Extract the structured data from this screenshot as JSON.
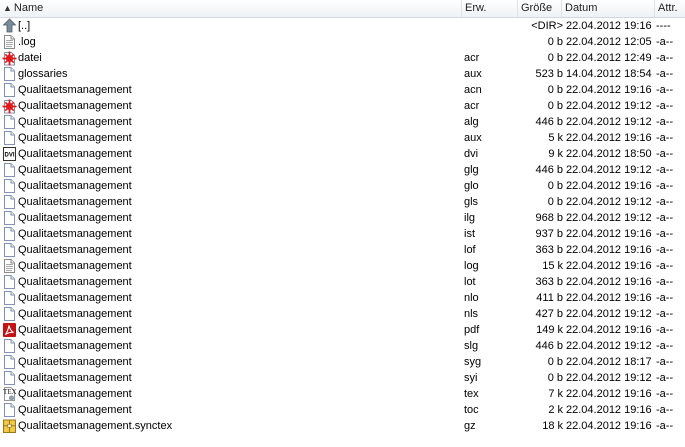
{
  "header": {
    "name": "Name",
    "ext": "Erw.",
    "size": "Größe",
    "date": "Datum",
    "attr": "Attr."
  },
  "files": [
    {
      "name": "[..]",
      "ext": "",
      "size": "<DIR>",
      "date": "22.04.2012 19:16",
      "attr": "----",
      "icon": "up-folder-icon"
    },
    {
      "name": ".log",
      "ext": "",
      "size": "0 b",
      "date": "22.04.2012 12:05",
      "attr": "-a--",
      "icon": "text-file-icon"
    },
    {
      "name": "datei",
      "ext": "acr",
      "size": "0 b",
      "date": "22.04.2012 12:49",
      "attr": "-a--",
      "icon": "acrobat-red-splash-icon"
    },
    {
      "name": "glossaries",
      "ext": "aux",
      "size": "523 b",
      "date": "14.04.2012 18:54",
      "attr": "-a--",
      "icon": "blank-file-icon"
    },
    {
      "name": "Qualitaetsmanagement",
      "ext": "acn",
      "size": "0 b",
      "date": "22.04.2012 19:16",
      "attr": "-a--",
      "icon": "blank-file-icon"
    },
    {
      "name": "Qualitaetsmanagement",
      "ext": "acr",
      "size": "0 b",
      "date": "22.04.2012 19:12",
      "attr": "-a--",
      "icon": "acrobat-red-splash-icon"
    },
    {
      "name": "Qualitaetsmanagement",
      "ext": "alg",
      "size": "446 b",
      "date": "22.04.2012 19:12",
      "attr": "-a--",
      "icon": "blank-file-icon"
    },
    {
      "name": "Qualitaetsmanagement",
      "ext": "aux",
      "size": "5 k",
      "date": "22.04.2012 19:16",
      "attr": "-a--",
      "icon": "blank-file-icon"
    },
    {
      "name": "Qualitaetsmanagement",
      "ext": "dvi",
      "size": "9 k",
      "date": "22.04.2012 18:50",
      "attr": "-a--",
      "icon": "dvi-file-icon"
    },
    {
      "name": "Qualitaetsmanagement",
      "ext": "glg",
      "size": "446 b",
      "date": "22.04.2012 19:12",
      "attr": "-a--",
      "icon": "blank-file-icon"
    },
    {
      "name": "Qualitaetsmanagement",
      "ext": "glo",
      "size": "0 b",
      "date": "22.04.2012 19:16",
      "attr": "-a--",
      "icon": "blank-file-icon"
    },
    {
      "name": "Qualitaetsmanagement",
      "ext": "gls",
      "size": "0 b",
      "date": "22.04.2012 19:12",
      "attr": "-a--",
      "icon": "blank-file-icon"
    },
    {
      "name": "Qualitaetsmanagement",
      "ext": "ilg",
      "size": "968 b",
      "date": "22.04.2012 19:12",
      "attr": "-a--",
      "icon": "blank-file-icon"
    },
    {
      "name": "Qualitaetsmanagement",
      "ext": "ist",
      "size": "937 b",
      "date": "22.04.2012 19:16",
      "attr": "-a--",
      "icon": "blank-file-icon"
    },
    {
      "name": "Qualitaetsmanagement",
      "ext": "lof",
      "size": "363 b",
      "date": "22.04.2012 19:16",
      "attr": "-a--",
      "icon": "blank-file-icon"
    },
    {
      "name": "Qualitaetsmanagement",
      "ext": "log",
      "size": "15 k",
      "date": "22.04.2012 19:16",
      "attr": "-a--",
      "icon": "text-file-icon"
    },
    {
      "name": "Qualitaetsmanagement",
      "ext": "lot",
      "size": "363 b",
      "date": "22.04.2012 19:16",
      "attr": "-a--",
      "icon": "blank-file-icon"
    },
    {
      "name": "Qualitaetsmanagement",
      "ext": "nlo",
      "size": "411 b",
      "date": "22.04.2012 19:16",
      "attr": "-a--",
      "icon": "blank-file-icon"
    },
    {
      "name": "Qualitaetsmanagement",
      "ext": "nls",
      "size": "427 b",
      "date": "22.04.2012 19:12",
      "attr": "-a--",
      "icon": "blank-file-icon"
    },
    {
      "name": "Qualitaetsmanagement",
      "ext": "pdf",
      "size": "149 k",
      "date": "22.04.2012 19:16",
      "attr": "-a--",
      "icon": "pdf-file-icon"
    },
    {
      "name": "Qualitaetsmanagement",
      "ext": "slg",
      "size": "446 b",
      "date": "22.04.2012 19:12",
      "attr": "-a--",
      "icon": "blank-file-icon"
    },
    {
      "name": "Qualitaetsmanagement",
      "ext": "syg",
      "size": "0 b",
      "date": "22.04.2012 18:17",
      "attr": "-a--",
      "icon": "blank-file-icon"
    },
    {
      "name": "Qualitaetsmanagement",
      "ext": "syi",
      "size": "0 b",
      "date": "22.04.2012 19:12",
      "attr": "-a--",
      "icon": "blank-file-icon"
    },
    {
      "name": "Qualitaetsmanagement",
      "ext": "tex",
      "size": "7 k",
      "date": "22.04.2012 19:16",
      "attr": "-a--",
      "icon": "tex-file-icon"
    },
    {
      "name": "Qualitaetsmanagement",
      "ext": "toc",
      "size": "2 k",
      "date": "22.04.2012 19:16",
      "attr": "-a--",
      "icon": "blank-file-icon"
    },
    {
      "name": "Qualitaetsmanagement.synctex",
      "ext": "gz",
      "size": "18 k",
      "date": "22.04.2012 19:16",
      "attr": "-a--",
      "icon": "archive-file-icon"
    }
  ]
}
